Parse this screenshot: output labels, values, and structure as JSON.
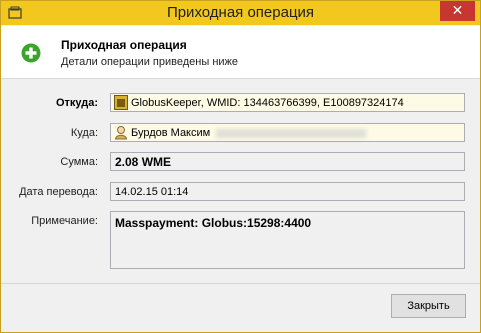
{
  "window": {
    "title": "Приходная операция",
    "close_label": "✕"
  },
  "header": {
    "title": "Приходная операция",
    "subtitle": "Детали операции приведены ниже"
  },
  "fields": {
    "from": {
      "label": "Откуда:",
      "value": "GlobusKeeper, WMID: 134463766399, E100897324174"
    },
    "to": {
      "label": "Куда:",
      "value": "Бурдов Максим"
    },
    "amount": {
      "label": "Сумма:",
      "value": "2.08 WME"
    },
    "date": {
      "label": "Дата перевода:",
      "value": "14.02.15 01:14"
    },
    "note": {
      "label": "Примечание:",
      "value": "Masspayment: Globus:15298:4400"
    }
  },
  "buttons": {
    "close": "Закрыть"
  },
  "icons": {
    "app": "wallet-icon",
    "header": "plus-icon",
    "from": "keeper-icon",
    "to": "person-icon"
  },
  "colors": {
    "titlebar": "#f2c81e",
    "close": "#c7372f",
    "plus": "#3aa52a",
    "field_highlight": "#fdfbe5"
  }
}
